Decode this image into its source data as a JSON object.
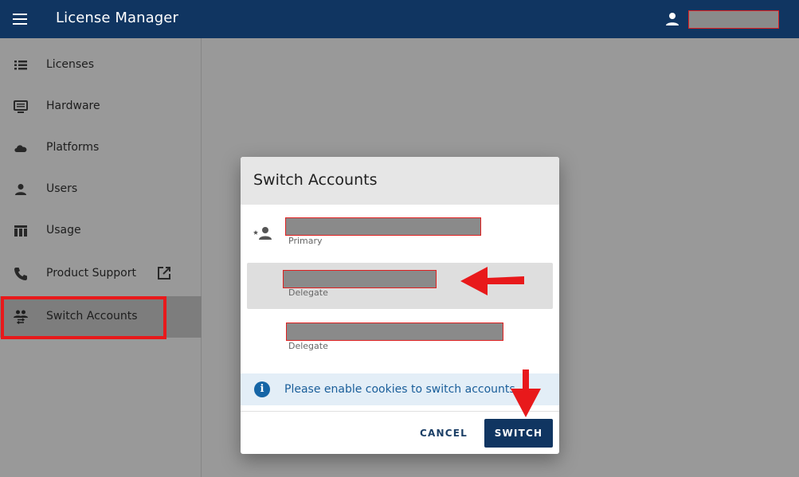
{
  "header": {
    "title": "License Manager",
    "user_name": ""
  },
  "sidebar": {
    "items": [
      {
        "label": "Licenses",
        "icon": "list-icon"
      },
      {
        "label": "Hardware",
        "icon": "monitor-icon"
      },
      {
        "label": "Platforms",
        "icon": "cloud-icon"
      },
      {
        "label": "Users",
        "icon": "person-icon"
      },
      {
        "label": "Usage",
        "icon": "table-icon"
      },
      {
        "label": "Product Support",
        "icon": "phone-icon",
        "external": true
      },
      {
        "label": "Switch Accounts",
        "icon": "switch-accounts-icon",
        "active": true
      }
    ]
  },
  "dialog": {
    "title": "Switch Accounts",
    "accounts": [
      {
        "name": "",
        "role": "Primary"
      },
      {
        "name": "",
        "role": "Delegate"
      },
      {
        "name": "",
        "role": "Delegate"
      }
    ],
    "info_text": "Please enable cookies to switch accounts",
    "cancel_label": "CANCEL",
    "switch_label": "SWITCH"
  },
  "colors": {
    "topbar": "#103561",
    "primary_button": "#103561",
    "annotation": "#e8191b",
    "info_banner": "#e3eef7"
  }
}
